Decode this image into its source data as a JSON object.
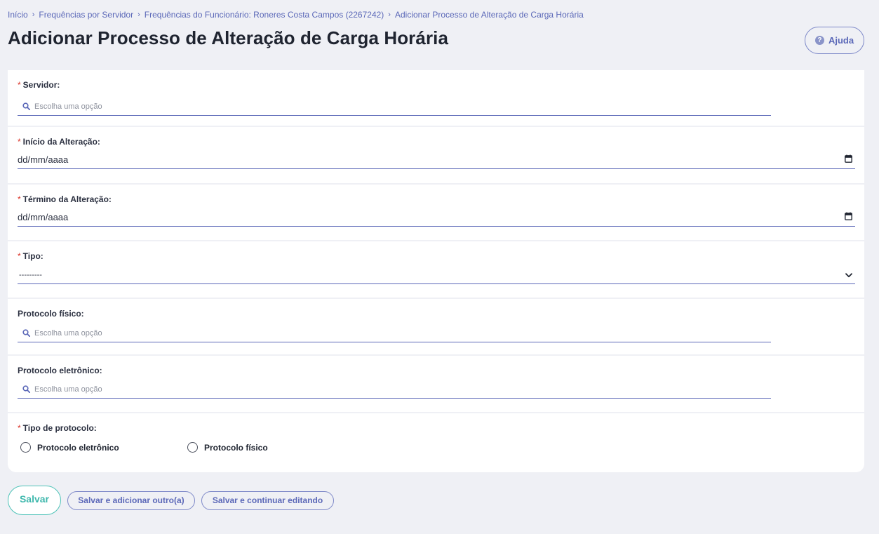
{
  "breadcrumb": [
    {
      "label": "Início"
    },
    {
      "label": "Frequências por Servidor"
    },
    {
      "label": "Frequências do Funcionário: Roneres Costa Campos (2267242)"
    },
    {
      "label": "Adicionar Processo de Alteração de Carga Horária"
    }
  ],
  "page_title": "Adicionar Processo de Alteração de Carga Horária",
  "help_label": "Ajuda",
  "required_mark": "*",
  "fields": {
    "servidor": {
      "label": "Servidor:",
      "placeholder": "Escolha uma opção",
      "required": true
    },
    "inicio": {
      "label": "Início da Alteração:",
      "value": "dd/mm/aaaa",
      "required": true
    },
    "termino": {
      "label": "Término da Alteração:",
      "value": "dd/mm/aaaa",
      "required": true
    },
    "tipo": {
      "label": "Tipo:",
      "value": "---------",
      "required": true
    },
    "protocolo_fisico": {
      "label": "Protocolo físico:",
      "placeholder": "Escolha uma opção",
      "required": false
    },
    "protocolo_eletronico": {
      "label": "Protocolo eletrônico:",
      "placeholder": "Escolha uma opção",
      "required": false
    },
    "tipo_protocolo": {
      "label": "Tipo de protocolo:",
      "required": true,
      "options": [
        {
          "label": "Protocolo eletrônico"
        },
        {
          "label": "Protocolo físico"
        }
      ]
    }
  },
  "actions": {
    "save": "Salvar",
    "save_add": "Salvar e adicionar outro(a)",
    "save_continue": "Salvar e continuar editando"
  },
  "colors": {
    "accent": "#5b68b8",
    "primary_button": "#3fb8ad",
    "required": "#d93025",
    "background": "#eff0f5"
  },
  "icons": [
    "chevron-right-icon",
    "help-icon",
    "search-icon",
    "calendar-icon",
    "chevron-down-icon"
  ]
}
